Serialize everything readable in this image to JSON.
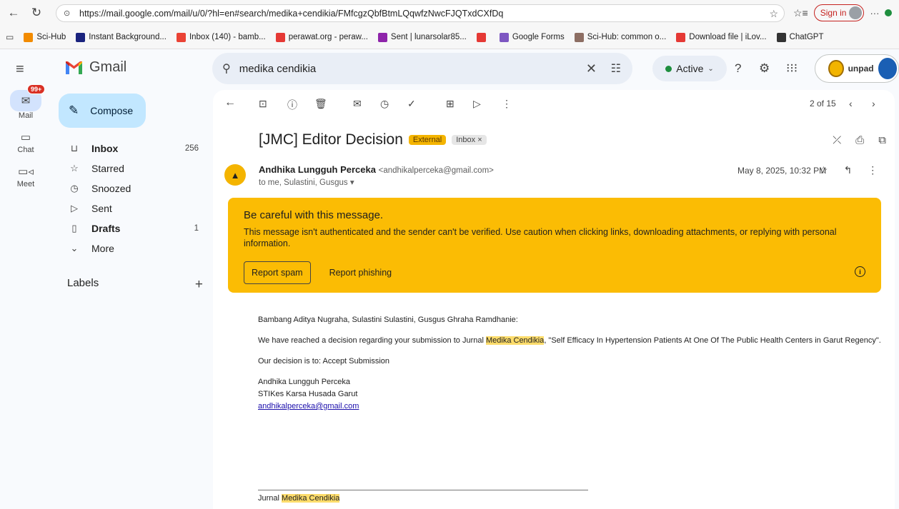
{
  "browser": {
    "url": "https://mail.google.com/mail/u/0/?hl=en#search/medika+cendikia/FMfcgzQbfBtmLQqwfzNwcFJQTxdCXfDq",
    "sign_in": "Sign in",
    "bookmarks": [
      {
        "label": "Sci-Hub",
        "color": "#f28b00"
      },
      {
        "label": "Instant Background...",
        "color": "#1a237e"
      },
      {
        "label": "Inbox (140) - bamb...",
        "color": "#ea4335"
      },
      {
        "label": "perawat.org - peraw...",
        "color": "#e53935"
      },
      {
        "label": "Sent | lunarsolar85...",
        "color": "#8e24aa"
      },
      {
        "label": "",
        "color": "#e53935"
      },
      {
        "label": "Google Forms",
        "color": "#7e57c2"
      },
      {
        "label": "Sci-Hub: common o...",
        "color": "#8d6e63"
      },
      {
        "label": "Download file | iLov...",
        "color": "#e53935"
      },
      {
        "label": "ChatGPT",
        "color": "#333333"
      }
    ]
  },
  "header": {
    "app_name": "Gmail",
    "search_value": "medika cendikia",
    "status": "Active"
  },
  "rail": {
    "mail": "Mail",
    "mail_badge": "99+",
    "chat": "Chat",
    "meet": "Meet"
  },
  "sidebar": {
    "compose": "Compose",
    "folders": [
      {
        "label": "Inbox",
        "count": "256"
      },
      {
        "label": "Starred",
        "count": ""
      },
      {
        "label": "Snoozed",
        "count": ""
      },
      {
        "label": "Sent",
        "count": ""
      },
      {
        "label": "Drafts",
        "count": "1"
      },
      {
        "label": "More",
        "count": ""
      }
    ],
    "labels_header": "Labels"
  },
  "toolbar": {
    "pager": "2 of 15"
  },
  "message": {
    "subject": "[JMC] Editor Decision",
    "tag_external": "External",
    "tag_inbox": "Inbox ×",
    "sender_name": "Andhika Lungguh Perceka",
    "sender_email": "<andhikalperceka@gmail.com>",
    "to_line": "to me, Sulastini, Gusgus ▾",
    "date": "May 8, 2025, 10:32 PM"
  },
  "warning": {
    "title": "Be careful with this message.",
    "text": "This message isn't authenticated and the sender can't be verified. Use caution when clicking links, downloading attachments, or replying with personal information.",
    "report_spam": "Report spam",
    "report_phishing": "Report phishing"
  },
  "body": {
    "greeting": "Bambang Aditya Nugraha, Sulastini Sulastini, Gusgus Ghraha Ramdhanie:",
    "p1_pre": "We have reached a decision regarding your submission to Jurnal ",
    "highlight": "Medika Cendikia",
    "p1_post": ", \"Self Efficacy In Hypertension Patients At One Of The Public Health Centers in Garut Regency\".",
    "decision": "Our decision is to: Accept Submission",
    "sig_name": "Andhika Lungguh Perceka",
    "sig_org": "STIKes Karsa Husada Garut",
    "sig_email": "andhikalperceka@gmail.com",
    "footer_pre": "Jurnal "
  }
}
